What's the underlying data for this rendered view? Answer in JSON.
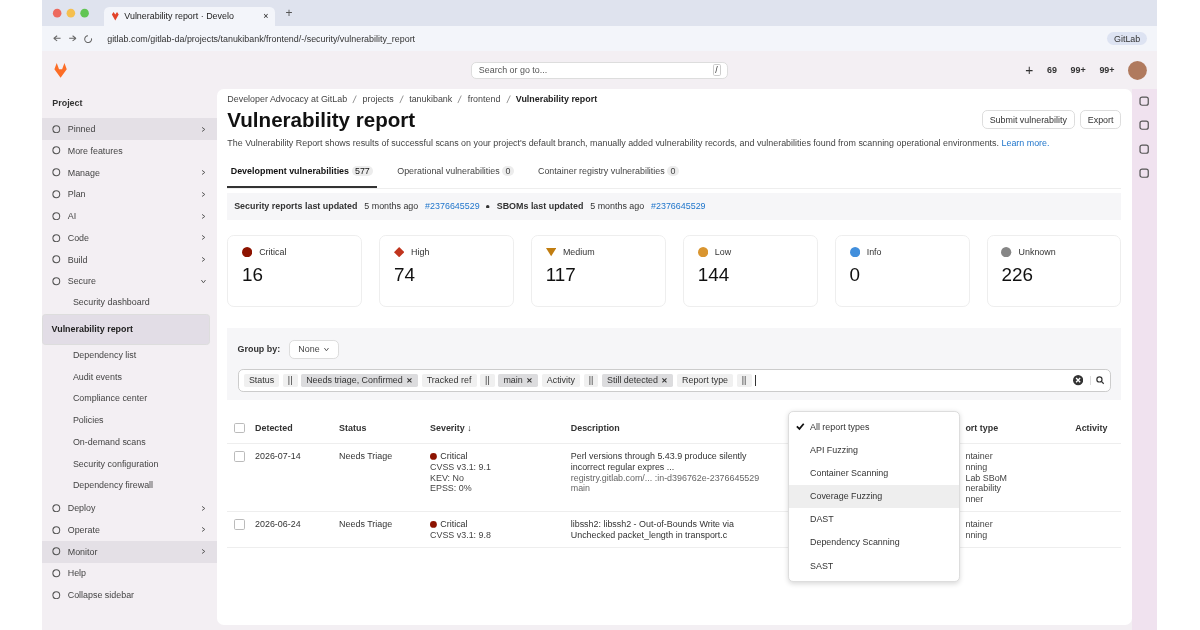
{
  "browser": {
    "tab_title": "Vulnerability report · Develo",
    "tab_close": "×",
    "new_tab": "+",
    "url": "gitlab.com/gitlab-da/projects/tanukibank/frontend/-/security/vulnerability_report",
    "profile": "GitLab"
  },
  "topbar": {
    "search_placeholder": "Search or go to...",
    "search_key": "/",
    "plus": "+",
    "counters": [
      "69",
      "99+",
      "99+"
    ]
  },
  "sidebar": {
    "title": "Project",
    "items": [
      {
        "label": "Pinned",
        "kind": "group",
        "expanded": false,
        "highlighted": true
      },
      {
        "label": "More features",
        "kind": "link",
        "highlighted": false
      },
      {
        "label": "Manage",
        "kind": "group",
        "expanded": false,
        "highlighted": false
      },
      {
        "label": "Plan",
        "kind": "group",
        "expanded": false,
        "highlighted": false
      },
      {
        "label": "AI",
        "kind": "group",
        "expanded": false,
        "highlighted": false
      },
      {
        "label": "Code",
        "kind": "group",
        "expanded": false,
        "highlighted": false
      },
      {
        "label": "Build",
        "kind": "group",
        "expanded": false,
        "highlighted": false
      },
      {
        "label": "Secure",
        "kind": "group",
        "expanded": true,
        "highlighted": false,
        "children": [
          {
            "label": "Security dashboard",
            "selected": false
          },
          {
            "label": "Vulnerability report",
            "selected": true
          },
          {
            "label": "Dependency list",
            "selected": false
          },
          {
            "label": "Audit events",
            "selected": false
          },
          {
            "label": "Compliance center",
            "selected": false
          },
          {
            "label": "Policies",
            "selected": false
          },
          {
            "label": "On-demand scans",
            "selected": false
          },
          {
            "label": "Security configuration",
            "selected": false
          },
          {
            "label": "Dependency firewall",
            "selected": false
          }
        ]
      },
      {
        "label": "Deploy",
        "kind": "group",
        "expanded": false,
        "highlighted": false
      },
      {
        "label": "Operate",
        "kind": "group",
        "expanded": false,
        "highlighted": false
      },
      {
        "label": "Monitor",
        "kind": "group",
        "expanded": false,
        "highlighted": true
      },
      {
        "label": "Help",
        "kind": "link",
        "highlighted": false
      },
      {
        "label": "Collapse sidebar",
        "kind": "link",
        "highlighted": false
      }
    ]
  },
  "breadcrumbs": [
    "Developer Advocacy at GitLab",
    "projects",
    "tanukibank",
    "frontend",
    "Vulnerability report"
  ],
  "page": {
    "title": "Vulnerability report",
    "actions": [
      "Submit vulnerability",
      "Export"
    ],
    "intro": "The Vulnerability Report shows results of successful scans on your project's default branch, manually added vulnerability records, and vulnerabilities found from scanning operational environments.",
    "learn_more": "Learn more."
  },
  "tabs": [
    {
      "label": "Development vulnerabilities",
      "count": "577",
      "selected": true
    },
    {
      "label": "Operational vulnerabilities",
      "count": "0",
      "selected": false
    },
    {
      "label": "Container registry vulnerabilities",
      "count": "0",
      "selected": false
    }
  ],
  "updated": [
    {
      "label": "Security reports last updated",
      "ago": "5 months ago",
      "link": "#2376645529"
    },
    {
      "label": "SBOMs last updated",
      "ago": "5 months ago",
      "link": "#2376645529"
    }
  ],
  "severity_cards": [
    {
      "label": "Critical",
      "count": "16",
      "kind": "circle",
      "color": "#8d1300"
    },
    {
      "label": "High",
      "count": "74",
      "kind": "diamond",
      "color": "#c0341d"
    },
    {
      "label": "Medium",
      "count": "117",
      "kind": "triangle",
      "color": "#c17d10"
    },
    {
      "label": "Low",
      "count": "144",
      "kind": "circle",
      "color": "#d99530"
    },
    {
      "label": "Info",
      "count": "0",
      "kind": "circle",
      "color": "#428fdc"
    },
    {
      "label": "Unknown",
      "count": "226",
      "kind": "circle",
      "color": "#868686"
    }
  ],
  "group_by": {
    "label": "Group by:",
    "value": "None"
  },
  "filters": [
    {
      "field": "Status",
      "operator": "||",
      "value": "Needs triage, Confirmed"
    },
    {
      "field": "Tracked ref",
      "operator": "||",
      "value": "main"
    },
    {
      "field": "Activity",
      "operator": "||",
      "value": "Still detected"
    },
    {
      "field": "Report type",
      "operator": "||"
    }
  ],
  "table": {
    "select_all_checked": false,
    "columns": [
      "Detected",
      "Status",
      "Severity ↓",
      "Description",
      "ort type",
      "Activity"
    ],
    "rows": [
      {
        "checked": false,
        "detected": "2026-07-14",
        "status": "Needs Triage",
        "severity": "Critical",
        "color": "#8d1300",
        "details": [
          "CVSS v3.1: 9.1",
          "KEV: No",
          "EPSS: 0%"
        ],
        "description": "Perl versions through 5.43.9 produce silently incorrect regular expres ...",
        "location": "registry.gitlab.com/... :in-d396762e-2376645529",
        "branch": "main",
        "report_type": [
          "ntainer",
          "nning",
          "Lab SBoM",
          "nerability",
          "nner"
        ]
      },
      {
        "checked": false,
        "detected": "2026-06-24",
        "status": "Needs Triage",
        "severity": "Critical",
        "color": "#8d1300",
        "details": [
          "CVSS v3.1: 9.8"
        ],
        "description": "libssh2: libssh2 - Out-of-Bounds Write via Unchecked packet_length in transport.c",
        "report_type": [
          "ntainer",
          "nning"
        ]
      }
    ]
  },
  "dropdown": {
    "items": [
      {
        "label": "All report types",
        "selected": true,
        "hovered": false
      },
      {
        "label": "API Fuzzing",
        "selected": false,
        "hovered": false
      },
      {
        "label": "Container Scanning",
        "selected": false,
        "hovered": false
      },
      {
        "label": "Coverage Fuzzing",
        "selected": false,
        "hovered": true
      },
      {
        "label": "DAST",
        "selected": false,
        "hovered": false
      },
      {
        "label": "Dependency Scanning",
        "selected": false,
        "hovered": false
      },
      {
        "label": "SAST",
        "selected": false,
        "hovered": false
      }
    ]
  }
}
